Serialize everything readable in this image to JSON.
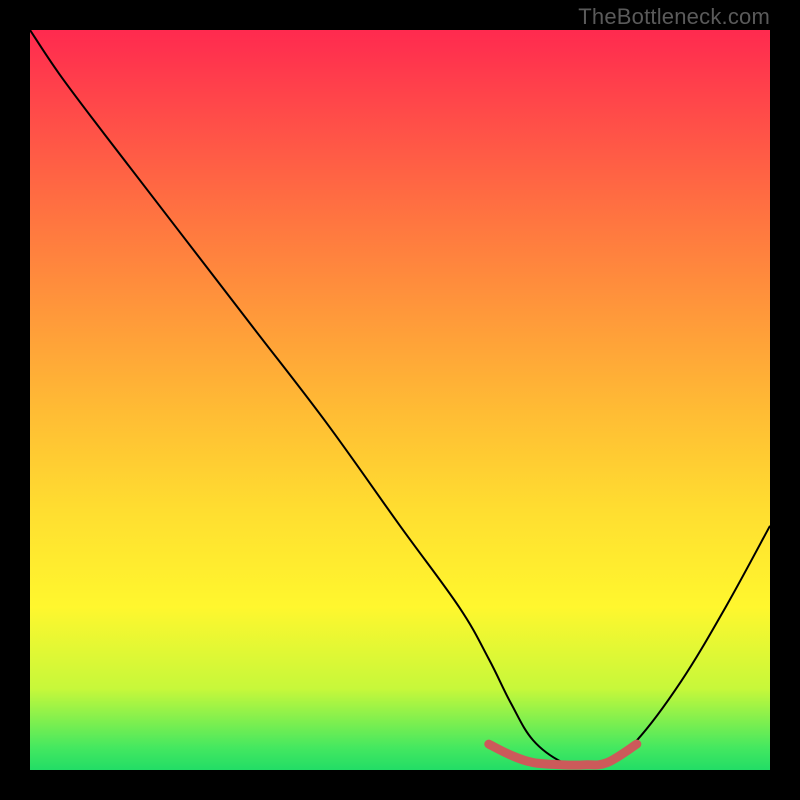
{
  "attribution": "TheBottleneck.com",
  "chart_data": {
    "type": "line",
    "title": "",
    "xlabel": "",
    "ylabel": "",
    "xlim": [
      0,
      100
    ],
    "ylim": [
      0,
      100
    ],
    "grid": false,
    "series": [
      {
        "name": "bottleneck-curve",
        "color": "#000000",
        "x": [
          0,
          4,
          10,
          20,
          30,
          40,
          50,
          58,
          62,
          65,
          68,
          72,
          75,
          78,
          82,
          88,
          94,
          100
        ],
        "y": [
          100,
          94,
          86,
          73,
          60,
          47,
          33,
          22,
          15,
          9,
          4,
          1,
          0.5,
          1,
          4,
          12,
          22,
          33
        ]
      },
      {
        "name": "optimal-range-marker",
        "color": "#cc5a5a",
        "x": [
          62,
          65,
          68,
          72,
          75,
          78,
          82
        ],
        "y": [
          3.5,
          2,
          1,
          0.7,
          0.7,
          1,
          3.5
        ]
      }
    ],
    "annotations": []
  },
  "colors": {
    "frame": "#000000",
    "curve": "#000000",
    "marker": "#cc5a5a",
    "gradient_top": "#ff2a4f",
    "gradient_bottom": "#22dd66"
  }
}
